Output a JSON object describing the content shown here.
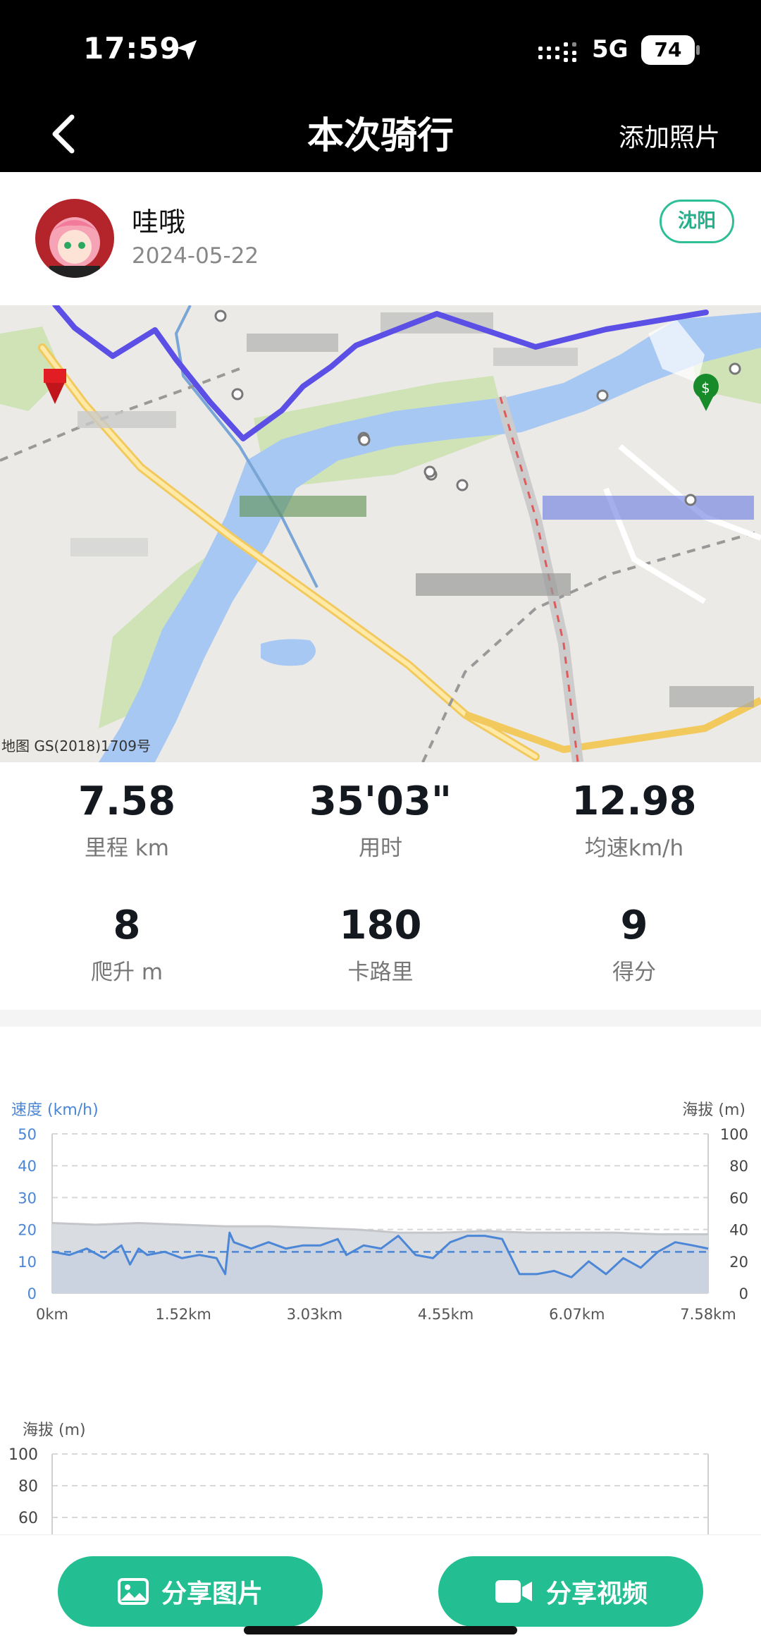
{
  "status_bar": {
    "time": "17:59",
    "network": "5G",
    "battery": "74"
  },
  "header": {
    "title": "本次骑行",
    "add_photo": "添加照片"
  },
  "user": {
    "name": "哇哦",
    "date": "2024-05-22",
    "city": "沈阳"
  },
  "map": {
    "credit": "地图  GS(2018)1709号"
  },
  "stats": [
    {
      "value": "7.58",
      "label": "里程 km"
    },
    {
      "value": "35'03\"",
      "label": "用时"
    },
    {
      "value": "12.98",
      "label": "均速km/h"
    },
    {
      "value": "8",
      "label": "爬升 m"
    },
    {
      "value": "180",
      "label": "卡路里"
    },
    {
      "value": "9",
      "label": "得分"
    }
  ],
  "chart_data": [
    {
      "type": "line",
      "ylabel": "速度 (km/h)",
      "ylabel_right": "海拔 (m)",
      "ylim": [
        0,
        50
      ],
      "ylim_right": [
        0,
        100
      ],
      "yticks": [
        "50",
        "40",
        "30",
        "20",
        "10",
        "0"
      ],
      "yticks_right": [
        "100",
        "80",
        "60",
        "40",
        "20",
        "0"
      ],
      "xticks": [
        "0km",
        "1.52km",
        "3.03km",
        "4.55km",
        "6.07km",
        "7.58km"
      ],
      "xlim": [
        0,
        7.58
      ],
      "average_speed": 12.98,
      "series": [
        {
          "axis": "left",
          "x": [
            0,
            0.2,
            0.4,
            0.6,
            0.8,
            0.9,
            1.0,
            1.1,
            1.3,
            1.5,
            1.7,
            1.9,
            2.0,
            2.05,
            2.1,
            2.3,
            2.5,
            2.7,
            2.9,
            3.1,
            3.3,
            3.4,
            3.6,
            3.8,
            4.0,
            4.2,
            4.4,
            4.6,
            4.8,
            5.0,
            5.2,
            5.4,
            5.6,
            5.8,
            6.0,
            6.2,
            6.4,
            6.6,
            6.8,
            7.0,
            7.2,
            7.4,
            7.58
          ],
          "y": [
            13,
            12,
            14,
            11,
            15,
            9,
            14,
            12,
            13,
            11,
            12,
            11,
            6,
            19,
            16,
            14,
            16,
            14,
            15,
            15,
            17,
            12,
            15,
            14,
            18,
            12,
            11,
            16,
            18,
            18,
            17,
            6,
            6,
            7,
            5,
            10,
            6,
            11,
            8,
            13,
            16,
            15,
            14
          ]
        },
        {
          "axis": "right",
          "x": [
            0,
            0.5,
            1.0,
            1.5,
            2.0,
            2.5,
            3.0,
            3.5,
            4.0,
            4.5,
            5.0,
            5.5,
            6.0,
            6.5,
            7.0,
            7.58
          ],
          "y": [
            44,
            43,
            44,
            43,
            42,
            42,
            41,
            40,
            38,
            38,
            39,
            38,
            38,
            38,
            37,
            37
          ]
        }
      ]
    },
    {
      "type": "line",
      "ylabel": "海拔 (m)",
      "yticks": [
        "100",
        "80",
        "60"
      ],
      "ylim": [
        0,
        100
      ],
      "series": []
    }
  ],
  "bottom": {
    "share_image": "分享图片",
    "share_video": "分享视频"
  }
}
